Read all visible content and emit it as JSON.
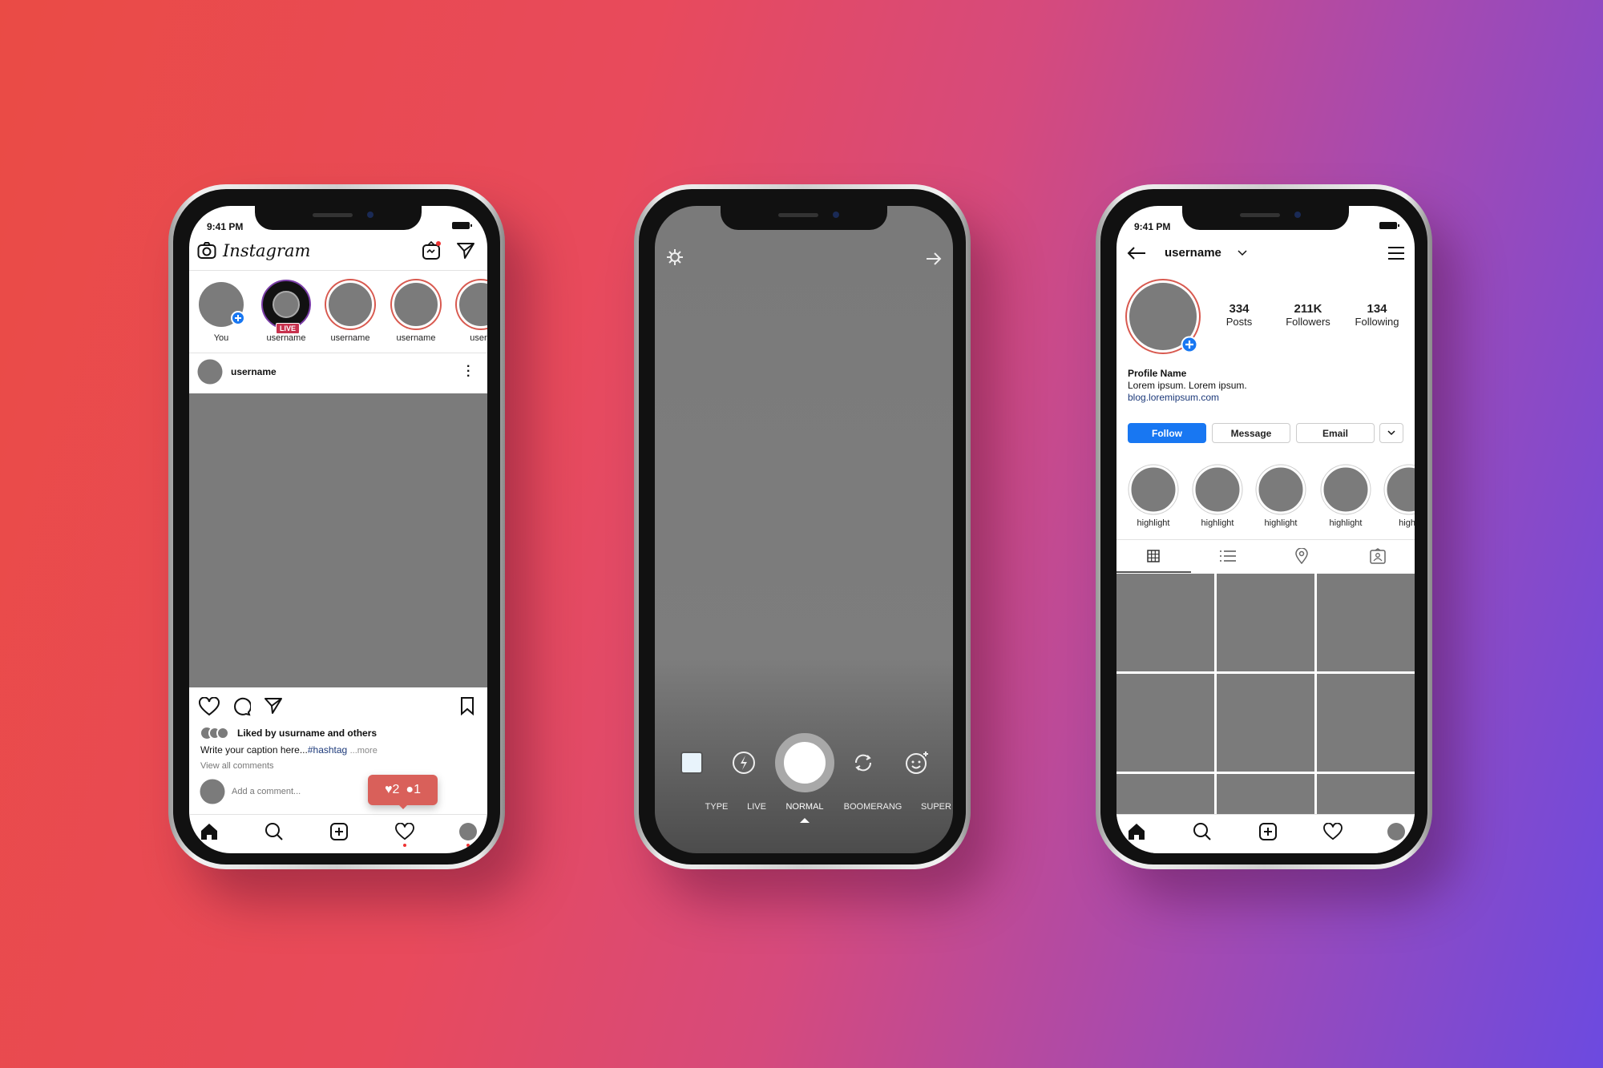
{
  "status": {
    "time": "9:41 PM"
  },
  "feed": {
    "brand": "Instagram",
    "stories": [
      {
        "label": "You"
      },
      {
        "label": "username",
        "live": "LIVE"
      },
      {
        "label": "username"
      },
      {
        "label": "username"
      },
      {
        "label": "usern"
      }
    ],
    "post": {
      "username": "username",
      "liked": "Liked by usurname and others",
      "caption": "Write your caption here...",
      "hashtag": "#hashtag",
      "more": "...more",
      "view_comments": "View all comments",
      "add_comment": "Add a comment..."
    },
    "notification": {
      "likes": "2",
      "comments": "1",
      "color": "#d9605a"
    }
  },
  "camera": {
    "modes": [
      "TYPE",
      "LIVE",
      "NORMAL",
      "BOOMERANG",
      "SUPER"
    ],
    "selected": "NORMAL"
  },
  "profile": {
    "username": "username",
    "stats": [
      {
        "value": "334",
        "label": "Posts"
      },
      {
        "value": "211K",
        "label": "Followers"
      },
      {
        "value": "134",
        "label": "Following"
      }
    ],
    "name": "Profile Name",
    "bio": "Lorem ipsum. Lorem ipsum.",
    "link": "blog.loremipsum.com",
    "buttons": {
      "follow": "Follow",
      "message": "Message",
      "email": "Email"
    },
    "highlights": [
      "highlight",
      "highlight",
      "highlight",
      "highlight",
      "highli"
    ],
    "accent": "#1877f2"
  }
}
